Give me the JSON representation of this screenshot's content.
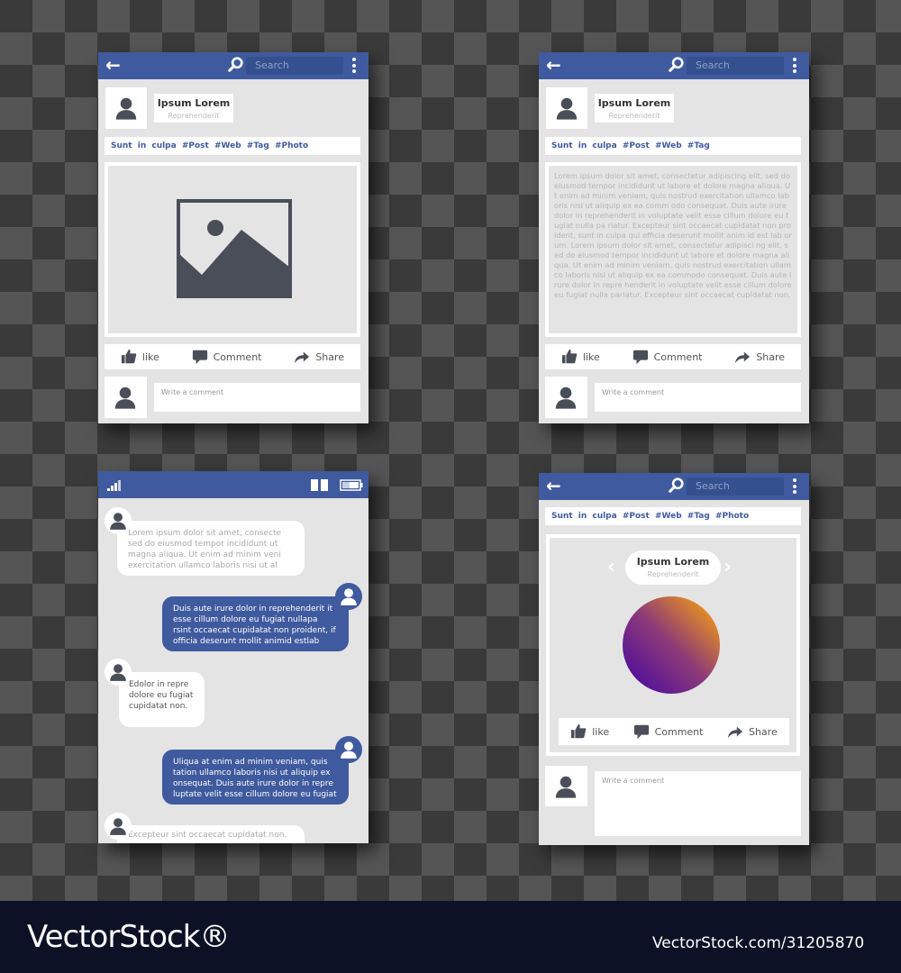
{
  "header": {
    "search_placeholder": "Search"
  },
  "profile": {
    "name": "Ipsum Lorem",
    "subtitle": "Reprehenderit"
  },
  "tags_a": "Sunt in culpa #Post #Web #Tag #Photo",
  "tags_b": "Sunt in culpa #Post #Web #Tag",
  "tags_d": "Sunt in culpa #Post #Web #Tag #Photo",
  "actions": {
    "like": "like",
    "comment": "Comment",
    "share": "Share"
  },
  "comment_placeholder": "Write a comment",
  "post_text": "Lorem ipsum dolor sit amet, consectetur adipiscing elit, sed do eiusmod tempor incididunt ut labore et dolore magna aliqua. Ut enim ad minim veniam, quis nostrud exercitation ullamco laboris nisi ut aliquip ex ea comm odo consequat. Duis aute irure dolor in reprehenderit in voluptate velit esse cillum dolore eu fugiat nulla pa riatur. Excepteur sint occaecat cupidatat non proident, sunt in culpa qui officia deserunt mollit anim id est lab orum. Lorem ipsum dolor sit amet, consectetur adipisci ng elit, sed do eiusmod tempor incididunt ut labore et dolore magna aliqua. Ut enim ad minim veniam, quis nostrud exercitation ullamco laboris nisi ut aliquip ex ea commodo consequat. Duis aute irure dolor in repre henderit in voluptate velit esse cillum dolore eu fugiat nulla pariatur. Excepteur sint occaecat cupidatat non.",
  "chat": {
    "messages": [
      {
        "side": "in",
        "text": "Lorem ipsum dolor sit amet, consecte sed do eiusmod tempor incididunt ut magna aliqua. Ut enim ad minim veni exercitation ullamco laboris nisi ut al"
      },
      {
        "side": "out",
        "text": "Duis aute irure dolor in reprehenderit it esse cillum dolore eu fugiat nullapa rsint occaecat cupidatat non proident, if officia deserunt mollit animid estlab"
      },
      {
        "side": "in",
        "text": "Edolor in repre dolore eu fugiat cupidatat non."
      },
      {
        "side": "out",
        "text": "Uliqua at enim ad minim veniam, quis tation ullamco laboris nisi ut aliquip ex onsequat. Duis aute irure dolor in repre luptate velit esse cillum dolore eu fugiat"
      },
      {
        "side": "in",
        "text": "Excepteur sint occaecat cupidatat non."
      }
    ]
  },
  "colors": {
    "brand": "#3f5a9e",
    "gradient_start": "#f7a012",
    "gradient_end": "#4a0aa0"
  },
  "footer": {
    "logo": "VectorStock®",
    "id": "VectorStock.com/31205870"
  }
}
